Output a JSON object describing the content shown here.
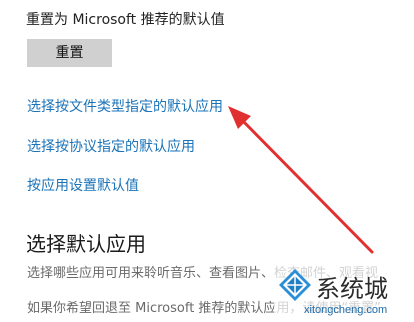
{
  "reset_section": {
    "heading": "重置为 Microsoft 推荐的默认值",
    "button_label": "重置"
  },
  "links": [
    "选择按文件类型指定的默认应用",
    "选择按协议指定的默认应用",
    "按应用设置默认值"
  ],
  "choose_section": {
    "title": "选择默认应用",
    "description_1": "选择哪些应用可用来聆听音乐、查看图片、检查邮件、观看视",
    "description_2": "如果你希望回退至 Microsoft 推荐的默认应用，请使用“重置”"
  },
  "watermark": {
    "name": "系统城",
    "url": "xitongcheng.com"
  },
  "colors": {
    "link": "#1b73b8",
    "arrow": "#e03030",
    "button_bg": "#d0d0d0"
  }
}
